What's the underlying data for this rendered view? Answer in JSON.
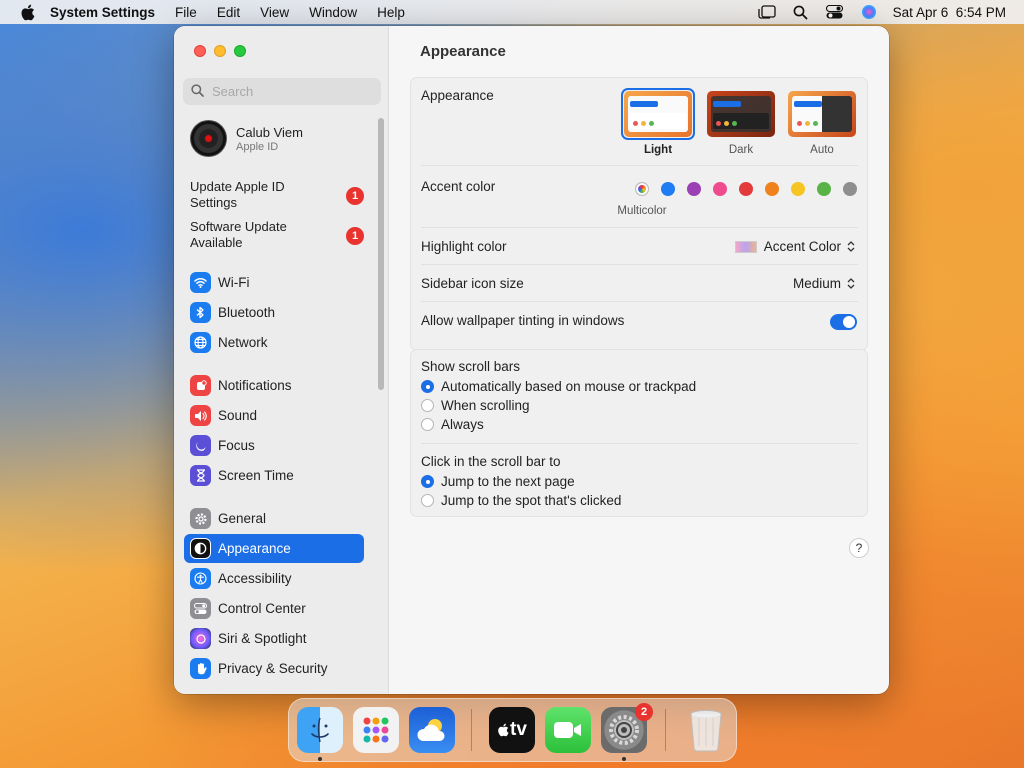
{
  "menubar": {
    "app_name": "System Settings",
    "menus": [
      "File",
      "Edit",
      "View",
      "Window",
      "Help"
    ],
    "clock": "Sat Apr 6  6:54 PM"
  },
  "sidebar": {
    "search_placeholder": "Search",
    "account": {
      "name": "Calub Viem",
      "subtitle": "Apple ID"
    },
    "notices": [
      {
        "label": "Update Apple ID Settings",
        "badge": "1"
      },
      {
        "label": "Software Update Available",
        "badge": "1"
      }
    ],
    "items": [
      {
        "label": "Wi-Fi",
        "icon": "wifi-icon",
        "color": "#1b7cf0"
      },
      {
        "label": "Bluetooth",
        "icon": "bluetooth-icon",
        "color": "#1b7cf0"
      },
      {
        "label": "Network",
        "icon": "globe-icon",
        "color": "#1b7cf0"
      },
      {
        "label": "Notifications",
        "icon": "bell-icon",
        "color": "#ef4444"
      },
      {
        "label": "Sound",
        "icon": "speaker-icon",
        "color": "#ef4444"
      },
      {
        "label": "Focus",
        "icon": "moon-icon",
        "color": "#5b4fd6"
      },
      {
        "label": "Screen Time",
        "icon": "hourglass-icon",
        "color": "#5b4fd6"
      },
      {
        "label": "General",
        "icon": "gear-icon",
        "color": "#8e8e93"
      },
      {
        "label": "Appearance",
        "icon": "appearance-icon",
        "color": "#111111"
      },
      {
        "label": "Accessibility",
        "icon": "accessibility-icon",
        "color": "#1b7cf0"
      },
      {
        "label": "Control Center",
        "icon": "toggles-icon",
        "color": "#8e8e93"
      },
      {
        "label": "Siri & Spotlight",
        "icon": "siri-icon",
        "color": "#9b4de0"
      },
      {
        "label": "Privacy & Security",
        "icon": "hand-icon",
        "color": "#1b7cf0"
      }
    ],
    "selected": "Appearance"
  },
  "main": {
    "title": "Appearance",
    "appearance": {
      "label": "Appearance",
      "options": [
        "Light",
        "Dark",
        "Auto"
      ],
      "selected": "Light"
    },
    "accent": {
      "label": "Accent color",
      "colors": [
        "multicolor",
        "#1f7cf2",
        "#9b3fb5",
        "#ee4c8e",
        "#e33b3b",
        "#f0821e",
        "#f6c522",
        "#57b346",
        "#8e8e8e"
      ],
      "selected_label": "Multicolor"
    },
    "highlight": {
      "label": "Highlight color",
      "value": "Accent Color"
    },
    "sidebar_icon_size": {
      "label": "Sidebar icon size",
      "value": "Medium"
    },
    "wallpaper_tinting": {
      "label": "Allow wallpaper tinting in windows",
      "on": true
    },
    "scroll_bars": {
      "label": "Show scroll bars",
      "options": [
        "Automatically based on mouse or trackpad",
        "When scrolling",
        "Always"
      ],
      "selected": 0
    },
    "click_scroll": {
      "label": "Click in the scroll bar to",
      "options": [
        "Jump to the next page",
        "Jump to the spot that's clicked"
      ],
      "selected": 0
    },
    "help": "?"
  },
  "dock": {
    "apps": [
      "Finder",
      "Launchpad",
      "Weather",
      "Apple TV",
      "FaceTime",
      "System Settings",
      "Trash"
    ],
    "settings_badge": "2",
    "tv_label": "tv"
  }
}
